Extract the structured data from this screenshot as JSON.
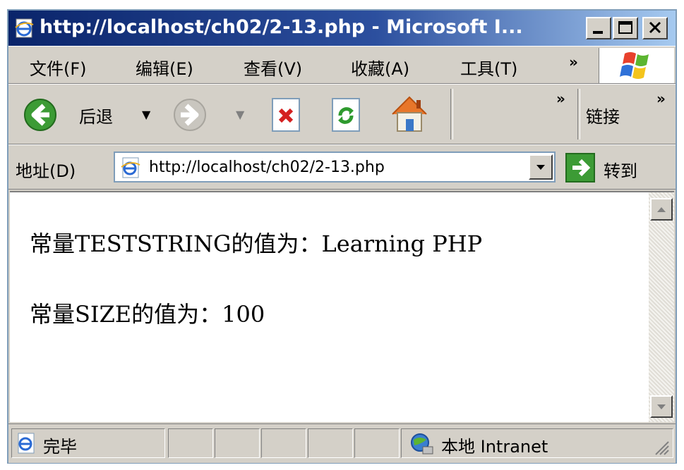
{
  "window": {
    "title": "http://localhost/ch02/2-13.php - Microsoft I..."
  },
  "menu": {
    "items": [
      "文件(F)",
      "编辑(E)",
      "查看(V)",
      "收藏(A)",
      "工具(T)"
    ],
    "overflow": "»"
  },
  "toolbar": {
    "back_label": "后退",
    "overflow": "»",
    "links_label": "链接",
    "links_overflow": "»"
  },
  "address": {
    "label": "地址(D)",
    "url": "http://localhost/ch02/2-13.php",
    "go_label": "转到"
  },
  "content": {
    "line1": "常量TESTSTRING的值为：Learning PHP",
    "line2": "常量SIZE的值为：100"
  },
  "status": {
    "text": "完毕",
    "zone": "本地 Intranet"
  },
  "icons": {
    "page": "ie-page-icon",
    "back": "back-arrow-icon",
    "forward": "forward-arrow-icon",
    "stop": "stop-icon",
    "refresh": "refresh-icon",
    "home": "home-icon",
    "go": "go-arrow-icon",
    "zone": "intranet-globe-icon",
    "logo": "windows-logo-icon"
  },
  "colors": {
    "titlebar_start": "#0a246a",
    "titlebar_end": "#a6caf0",
    "chrome": "#d4d0c8",
    "address_border": "#7f9db9"
  }
}
